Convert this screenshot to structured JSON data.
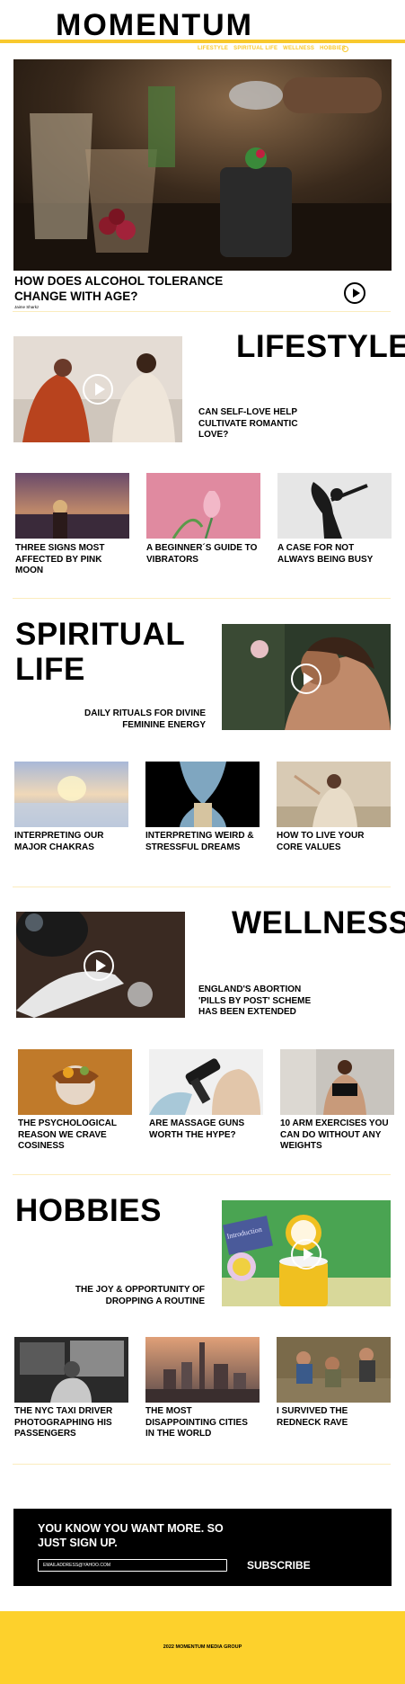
{
  "header": {
    "logo": "MOMENTUM",
    "nav": [
      "LIFESTYLE",
      "SPIRITUAL LIFE",
      "WELLNESS",
      "HOBBIES"
    ]
  },
  "hero": {
    "headline": "HOW DOES ALCOHOL TOLERANCE CHANGE WITH AGE?",
    "author": "Jaime Sharkz"
  },
  "lifestyle": {
    "title": "LIFESTYLE",
    "feature": "CAN SELF-LOVE HELP CULTIVATE ROMANTIC LOVE?",
    "items": [
      "THREE SIGNS MOST AFFECTED BY PINK MOON",
      "A BEGINNER´S GUIDE TO VIBRATORS",
      "A CASE FOR NOT ALWAYS BEING BUSY"
    ]
  },
  "spiritual": {
    "title_line1": "SPIRITUAL",
    "title_line2": "LIFE",
    "feature": "DAILY RITUALS FOR DIVINE FEMININE ENERGY",
    "items": [
      "INTERPRETING OUR MAJOR CHAKRAS",
      "INTERPRETING WEIRD & STRESSFUL DREAMS",
      "HOW TO LIVE YOUR CORE VALUES"
    ]
  },
  "wellness": {
    "title": "WELLNESS",
    "feature": "ENGLAND'S ABORTION 'PILLS BY POST' SCHEME HAS BEEN EXTENDED",
    "items": [
      "THE PSYCHOLOGICAL REASON WE CRAVE COSINESS",
      "ARE MASSAGE GUNS WORTH THE HYPE?",
      "10 ARM EXERCISES YOU CAN DO WITHOUT ANY WEIGHTS"
    ]
  },
  "hobbies": {
    "title": "HOBBIES",
    "feature": "THE JOY & OPPORTUNITY OF DROPPING A ROUTINE",
    "items": [
      "THE NYC TAXI DRIVER PHOTOGRAPHING HIS PASSENGERS",
      "THE MOST DISAPPOINTING CITIES IN THE WORLD",
      "I SURVIVED THE REDNECK RAVE"
    ],
    "book_text": "Introduction"
  },
  "signup": {
    "heading": "YOU KNOW YOU WANT MORE. SO JUST SIGN UP.",
    "email_placeholder": "EMAILADDRESS@YAHOO.COM",
    "button": "SUBSCRIBE"
  },
  "footer": {
    "text": "2022 MOMENTUM MEDIA GROUP"
  },
  "colors": {
    "accent": "#f8c92e",
    "footer": "#fdd12c",
    "signup_bg": "#000000"
  },
  "icons": [
    "search-icon",
    "play-icon"
  ]
}
